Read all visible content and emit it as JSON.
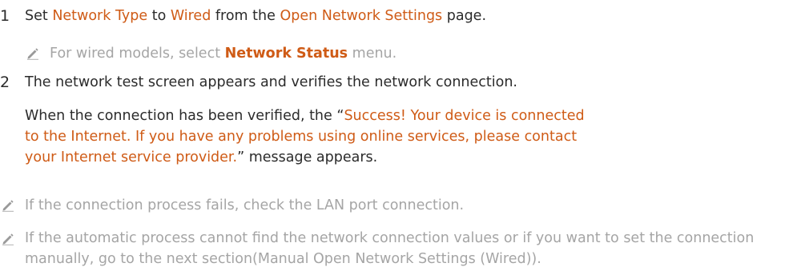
{
  "steps": [
    {
      "number": "1",
      "parts": [
        "Set ",
        "Network Type",
        " to ",
        "Wired",
        " from the ",
        "Open Network Settings",
        " page."
      ]
    },
    {
      "number": "2",
      "text": "The network test screen appears and verifies the network connection."
    }
  ],
  "step1_note": {
    "icon": "pencil-icon",
    "prefix": "For wired models, select ",
    "highlight": "Network Status",
    "suffix": " menu."
  },
  "step2_detail": {
    "prefix": "When the connection has been verified, the “",
    "message": "Success! Your device is connected to the Internet. If you have any problems using online services, please contact your Internet service provider.",
    "suffix": "” message appears."
  },
  "notes": [
    "If the connection process fails, check the LAN port connection.",
    "If the automatic process cannot find the network connection values or if you want to set the connection manually, go to the next section(Manual Open Network Settings (Wired))."
  ],
  "colors": {
    "accent": "#cf5b16",
    "text": "#2b2b2b",
    "note": "#a5a5a5"
  }
}
